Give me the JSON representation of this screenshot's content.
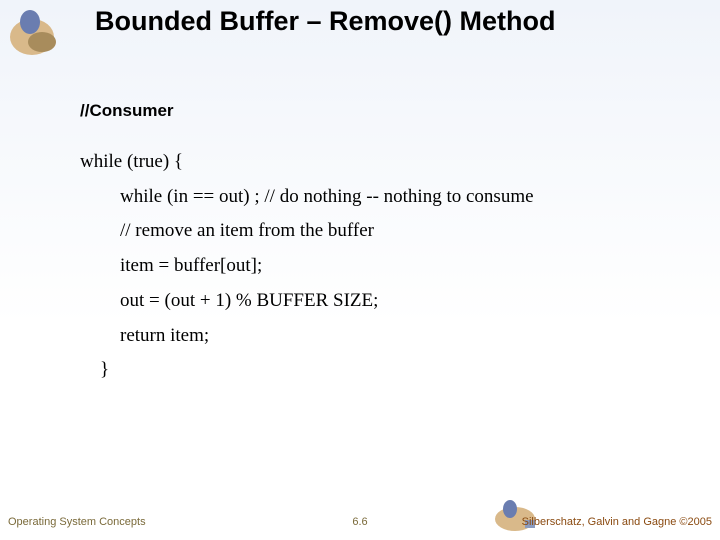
{
  "title": "Bounded Buffer – Remove() Method",
  "consumer_comment": "//Consumer",
  "code": {
    "l1": "while (true) {",
    "l2": "while (in == out)  ; // do nothing -- nothing to consume",
    "l3": "// remove an item from the buffer",
    "l4": "item = buffer[out];",
    "l5": "out = (out + 1) % BUFFER SIZE;",
    "l6": "return item;",
    "l7": "}"
  },
  "footer": {
    "left": "Operating System Concepts",
    "center": "6.6",
    "right": "Silberschatz, Galvin and Gagne ©2005"
  }
}
